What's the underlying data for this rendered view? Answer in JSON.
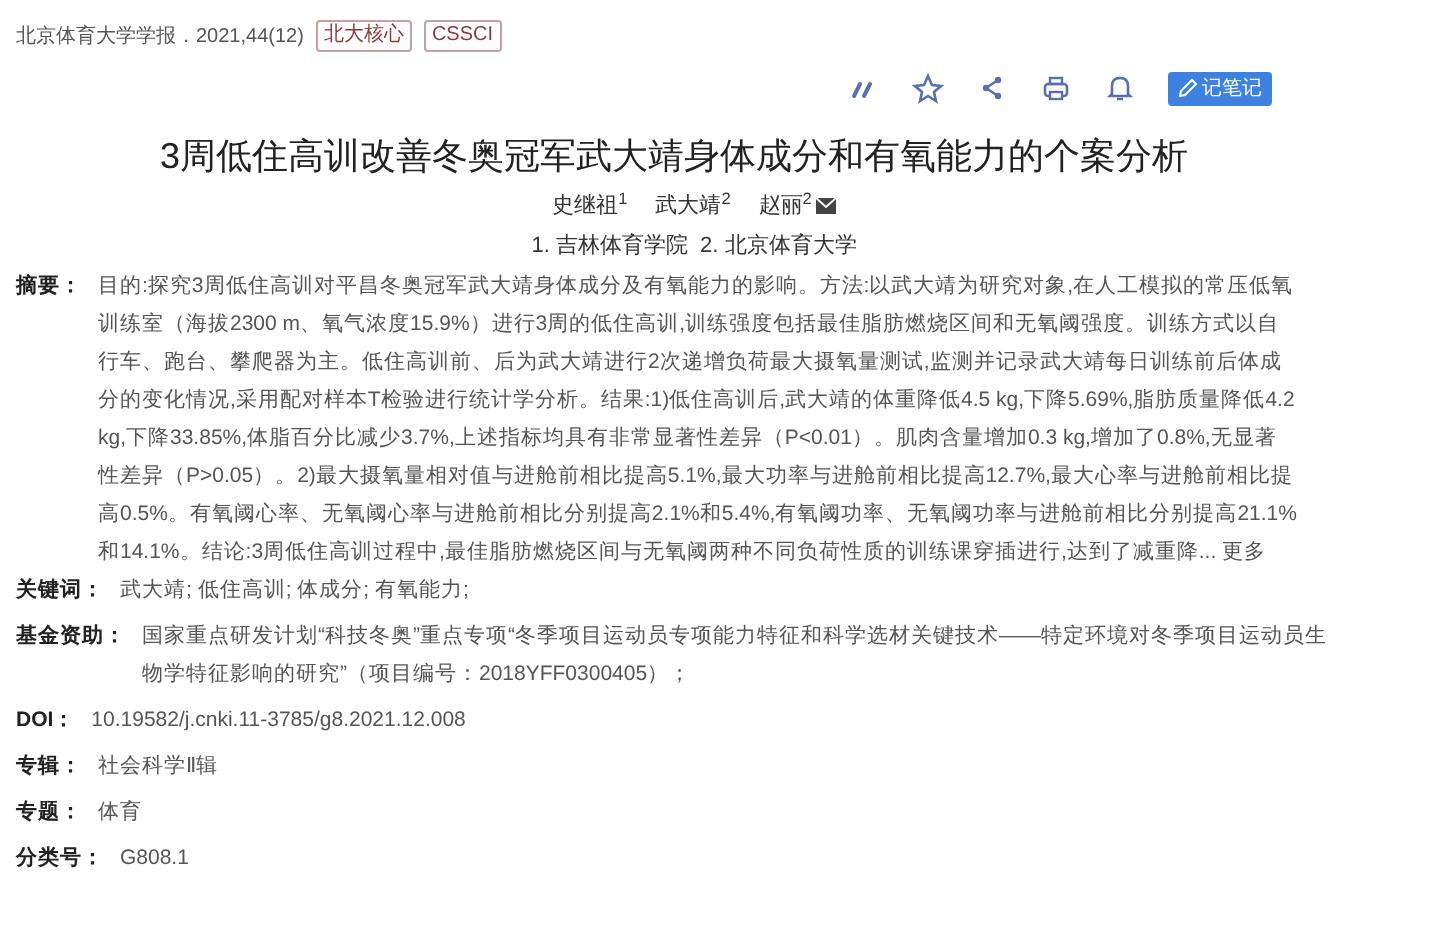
{
  "source": "北京体育大学学报．2021,44(12)",
  "badges": [
    "北大核心",
    "CSSCI"
  ],
  "toolbar": {
    "icons": [
      {
        "kind": "quote"
      },
      {
        "kind": "star"
      },
      {
        "kind": "share"
      },
      {
        "kind": "print"
      },
      {
        "kind": "bell"
      }
    ],
    "note_button": "记笔记"
  },
  "title": "3周低住高训改善冬奥冠军武大靖身体成分和有氧能力的个案分析",
  "authors": [
    {
      "name": "史继祖$^{1}$",
      "email": false
    },
    {
      "name": "武大靖$^{2}$",
      "email": false
    },
    {
      "name": "赵丽$^{2}$",
      "email": true
    }
  ],
  "affiliations": "1. 吉林体育学院  2. 北京体育大学",
  "fields": [
    {
      "label": "摘要：",
      "value": "目的:探究3周低住高训对平昌冬奥冠军武大靖身体成分及有氧能力的影响。方法:以武大靖为研究对象,在人工模拟的常压低氧训练室（海拔2300 m、氧气浓度15.9%）进行3周的低住高训,训练强度包括最佳脂肪燃烧区间和无氧阈强度。训练方式以自行车、跑台、攀爬器为主。低住高训前、后为武大靖进行2次递增负荷最大摄氧量测试,监测并记录武大靖每日训练前后体成分的变化情况,采用配对样本T检验进行统计学分析。结果:1)低住高训后,武大靖的体重降低4.5 kg,下降5.69%,脂肪质量降低4.2 kg,下降33.85%,体脂百分比减少3.7%,上述指标均具有非常显著性差异（P<0.01）。肌肉含量增加0.3 kg,增加了0.8%,无显著性差异（P>0.05）。2)最大摄氧量相对值与进舱前相比提高5.1%,最大功率与进舱前相比提高12.7%,最大心率与进舱前相比提高0.5%。有氧阈心率、无氧阈心率与进舱前相比分别提高2.1%和5.4%,有氧阈功率、无氧阈功率与进舱前相比分别提高21.1%和14.1%。结论:3周低住高训过程中,最佳脂肪燃烧区间与无氧阈两种不同负荷性质的训练课穿插进行,达到了减重降...",
      "more": "更多"
    },
    {
      "label": "关键词：",
      "value": "武大靖;  低住高训;  体成分;  有氧能力;"
    },
    {
      "label": "基金资助：",
      "value": "国家重点研发计划“科技冬奥”重点专项“冬季项目运动员专项能力特征和科学选材关键技术——特定环境对冬季项目运动员生物学特征影响的研究”（项目编号：2018YFF0300405）；"
    },
    {
      "label": "DOI：",
      "value": "10.19582/j.cnki.11-3785/g8.2021.12.008"
    },
    {
      "label": "专辑：",
      "value": "社会科学Ⅱ辑"
    },
    {
      "label": "专题：",
      "value": "体育"
    },
    {
      "label": "分类号：",
      "value": "G808.1"
    }
  ]
}
